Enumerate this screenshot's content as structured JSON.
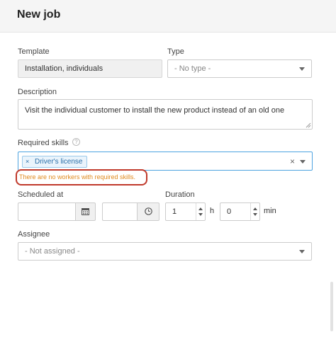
{
  "header": {
    "title": "New job"
  },
  "template": {
    "label": "Template",
    "value": "Installation, individuals"
  },
  "type": {
    "label": "Type",
    "value": "- No type -"
  },
  "description": {
    "label": "Description",
    "value": "Visit the individual customer to install the new product instead of an old one"
  },
  "skills": {
    "label": "Required skills",
    "help_icon": "?",
    "tags": [
      "Driver's license"
    ],
    "remove_tag": "×",
    "clear": "×",
    "warning": "There are no workers with required skills."
  },
  "scheduled": {
    "label": "Scheduled at",
    "date_value": "",
    "time_value": ""
  },
  "duration": {
    "label": "Duration",
    "hours": "1",
    "hours_unit": "h",
    "minutes": "0",
    "minutes_unit": "min"
  },
  "assignee": {
    "label": "Assignee",
    "value": "- Not assigned -"
  },
  "icons": {
    "calendar": "calendar-icon",
    "clock": "clock-icon"
  },
  "colors": {
    "accent": "#4da3e0",
    "warning_text": "#e08a1e",
    "highlight_border": "#c0392b"
  }
}
